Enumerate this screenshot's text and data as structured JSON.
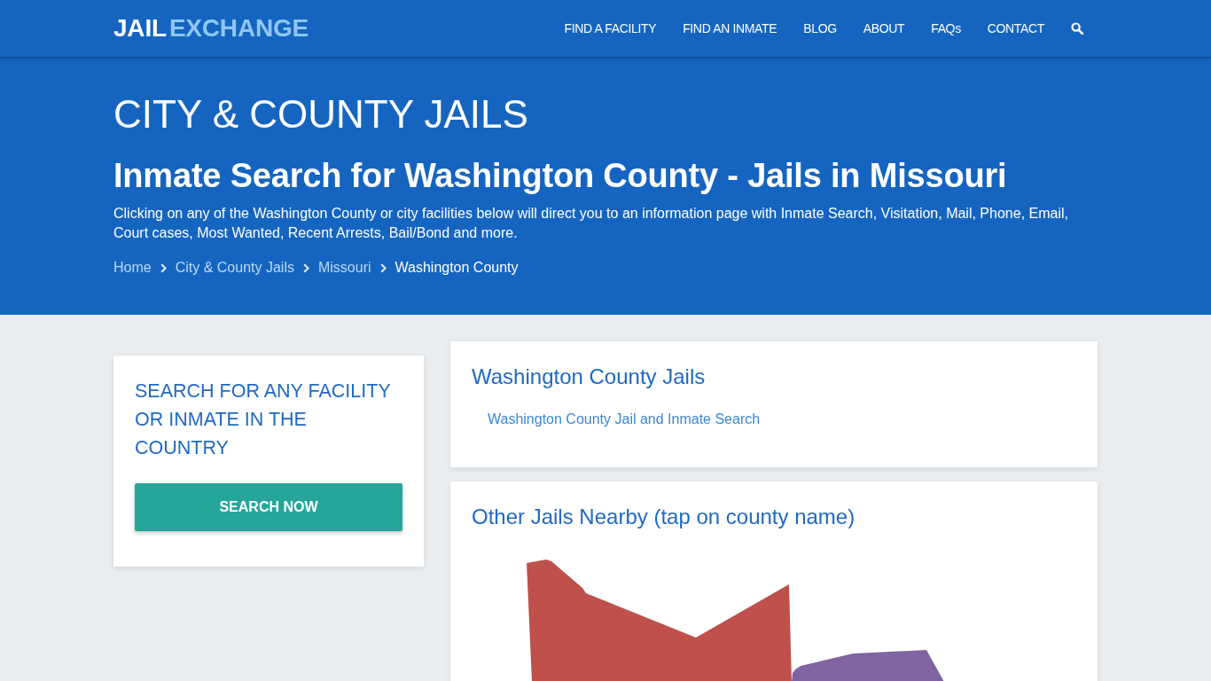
{
  "header": {
    "logo": {
      "primary": "JAIL",
      "secondary": "EXCHANGE"
    },
    "nav": [
      "FIND A FACILITY",
      "FIND AN INMATE",
      "BLOG",
      "ABOUT",
      "FAQs",
      "CONTACT"
    ]
  },
  "hero": {
    "category": "CITY & COUNTY JAILS",
    "title": "Inmate Search for Washington County - Jails in Missouri",
    "description": "Clicking on any of the Washington County or city facilities below will direct you to an information page with Inmate Search, Visitation, Mail, Phone, Email, Court cases, Most Wanted, Recent Arrests, Bail/Bond and more.",
    "breadcrumb": [
      {
        "label": "Home",
        "current": false
      },
      {
        "label": "City & County Jails",
        "current": false
      },
      {
        "label": "Missouri",
        "current": false
      },
      {
        "label": "Washington County",
        "current": true
      }
    ]
  },
  "search_card": {
    "heading": "SEARCH FOR ANY FACILITY OR INMATE IN THE COUNTRY",
    "button": "SEARCH NOW"
  },
  "jails_card": {
    "heading": "Washington County Jails",
    "links": [
      "Washington County Jail and Inmate Search"
    ]
  },
  "nearby_card": {
    "heading": "Other Jails Nearby (tap on county name)"
  }
}
